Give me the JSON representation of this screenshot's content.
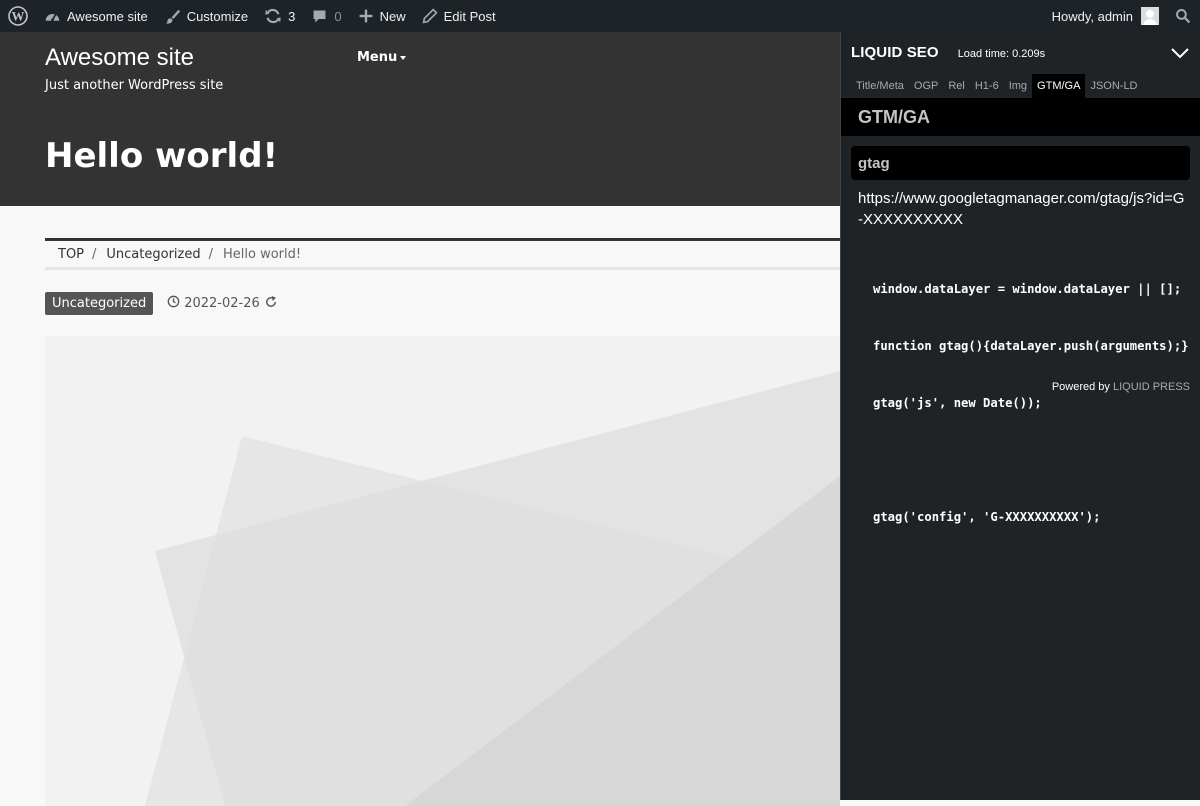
{
  "adminbar": {
    "wp_icon": "wordpress-logo-icon",
    "site_name": "Awesome site",
    "customize": "Customize",
    "updates_count": "3",
    "comments_count": "0",
    "new_label": "New",
    "edit_post": "Edit Post",
    "howdy": "Howdy, admin"
  },
  "header": {
    "site_title": "Awesome site",
    "site_description": "Just another WordPress site",
    "menu_label": "Menu",
    "post_title": "Hello world!"
  },
  "breadcrumb": {
    "items": [
      "TOP",
      "Uncategorized",
      "Hello world!"
    ],
    "separator": "/"
  },
  "meta": {
    "category": "Uncategorized",
    "date": "2022-02-26"
  },
  "seo_panel": {
    "title": "LIQUID SEO",
    "load_time": "Load time: 0.209s",
    "tabs": [
      "Title/Meta",
      "OGP",
      "Rel",
      "H1-6",
      "Img",
      "GTM/GA",
      "JSON-LD"
    ],
    "active_tab": "GTM/GA",
    "section_title": "GTM/GA",
    "subsection_title": "gtag",
    "script_url": "https://www.googletagmanager.com/gtag/js?id=G-XXXXXXXXXX",
    "code_lines": [
      "window.dataLayer = window.dataLayer || [];",
      "function gtag(){dataLayer.push(arguments);}",
      "gtag('js', new Date());",
      "",
      "gtag('config', 'G-XXXXXXXXXX');"
    ],
    "powered_by": "Powered by",
    "powered_brand": "LIQUID PRESS"
  },
  "colors": {
    "adminbar_bg": "#1d2327",
    "header_bg": "#333333",
    "panel_bg": "#1f2326",
    "category_badge_bg": "#555555"
  }
}
